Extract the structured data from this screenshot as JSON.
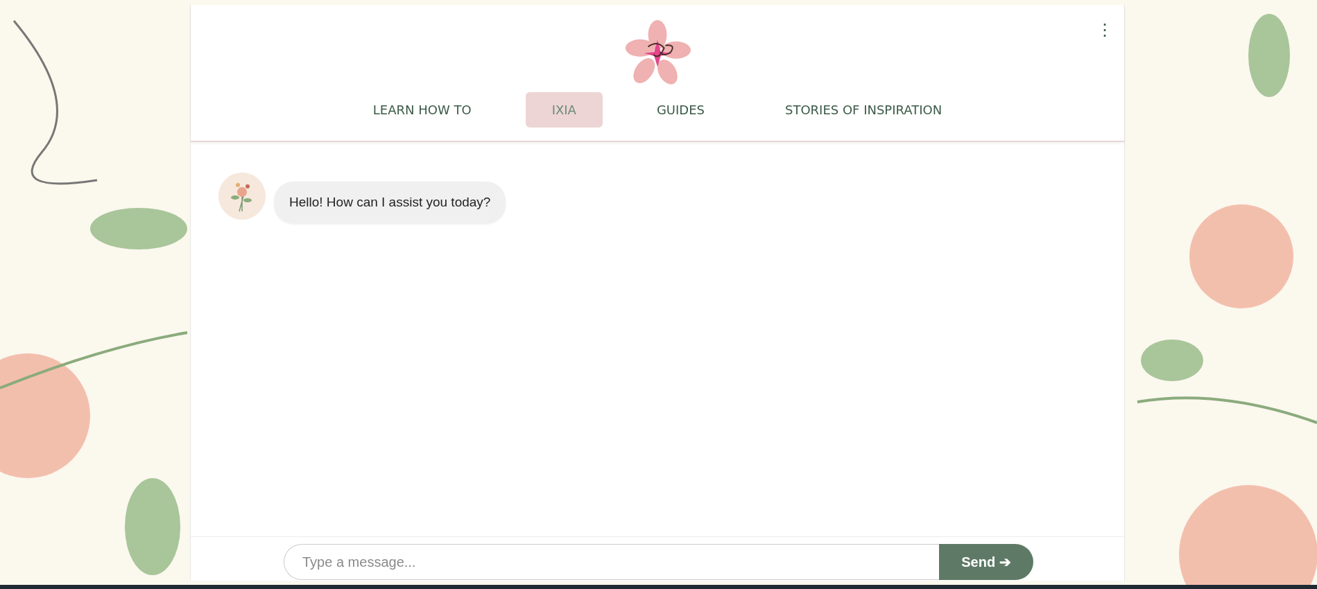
{
  "header": {
    "menu": "⋮"
  },
  "nav": [
    {
      "label": "LEARN HOW TO",
      "selected": false
    },
    {
      "label": "IXIA",
      "selected": true
    },
    {
      "label": "GUIDES",
      "selected": false
    },
    {
      "label": "STORIES OF INSPIRATION",
      "selected": false
    }
  ],
  "messages": [
    {
      "text": "Hello! How can I assist you today?"
    }
  ],
  "composer": {
    "placeholder": "Type a message...",
    "send": "Send ➔"
  }
}
